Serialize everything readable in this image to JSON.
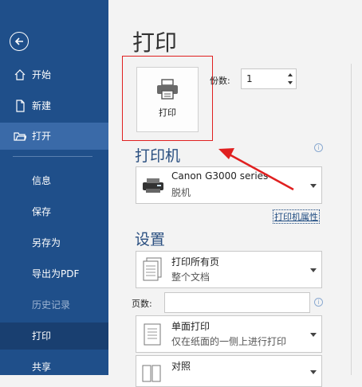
{
  "sidebar": {
    "back_icon": "back-arrow-icon",
    "items": [
      {
        "label": "开始",
        "icon": "home-icon"
      },
      {
        "label": "新建",
        "icon": "new-document-icon"
      },
      {
        "label": "打开",
        "icon": "folder-open-icon"
      },
      {
        "label": "信息"
      },
      {
        "label": "保存"
      },
      {
        "label": "另存为"
      },
      {
        "label": "导出为PDF"
      },
      {
        "label": "历史记录"
      },
      {
        "label": "打印"
      },
      {
        "label": "共享"
      }
    ]
  },
  "main": {
    "title": "打印",
    "print_button": {
      "label": "打印",
      "icon": "printer-icon"
    },
    "copies": {
      "label": "份数:",
      "value": "1"
    },
    "printer_section": {
      "title": "打印机",
      "printer_name": "Canon G3000 series",
      "printer_status": "脱机",
      "properties_link": "打印机属性"
    },
    "settings_section": {
      "title": "设置",
      "print_range": {
        "line1": "打印所有页",
        "line2": "整个文档"
      },
      "pages_label": "页数:",
      "pages_value": "",
      "sides": {
        "line1": "单面打印",
        "line2": "仅在纸面的一侧上进行打印"
      },
      "collate": {
        "line1": "对照",
        "line2": ""
      }
    }
  },
  "colors": {
    "sidebar_bg": "#1f4f8a",
    "highlight": "#e02020",
    "section_title": "#2a4f80"
  }
}
